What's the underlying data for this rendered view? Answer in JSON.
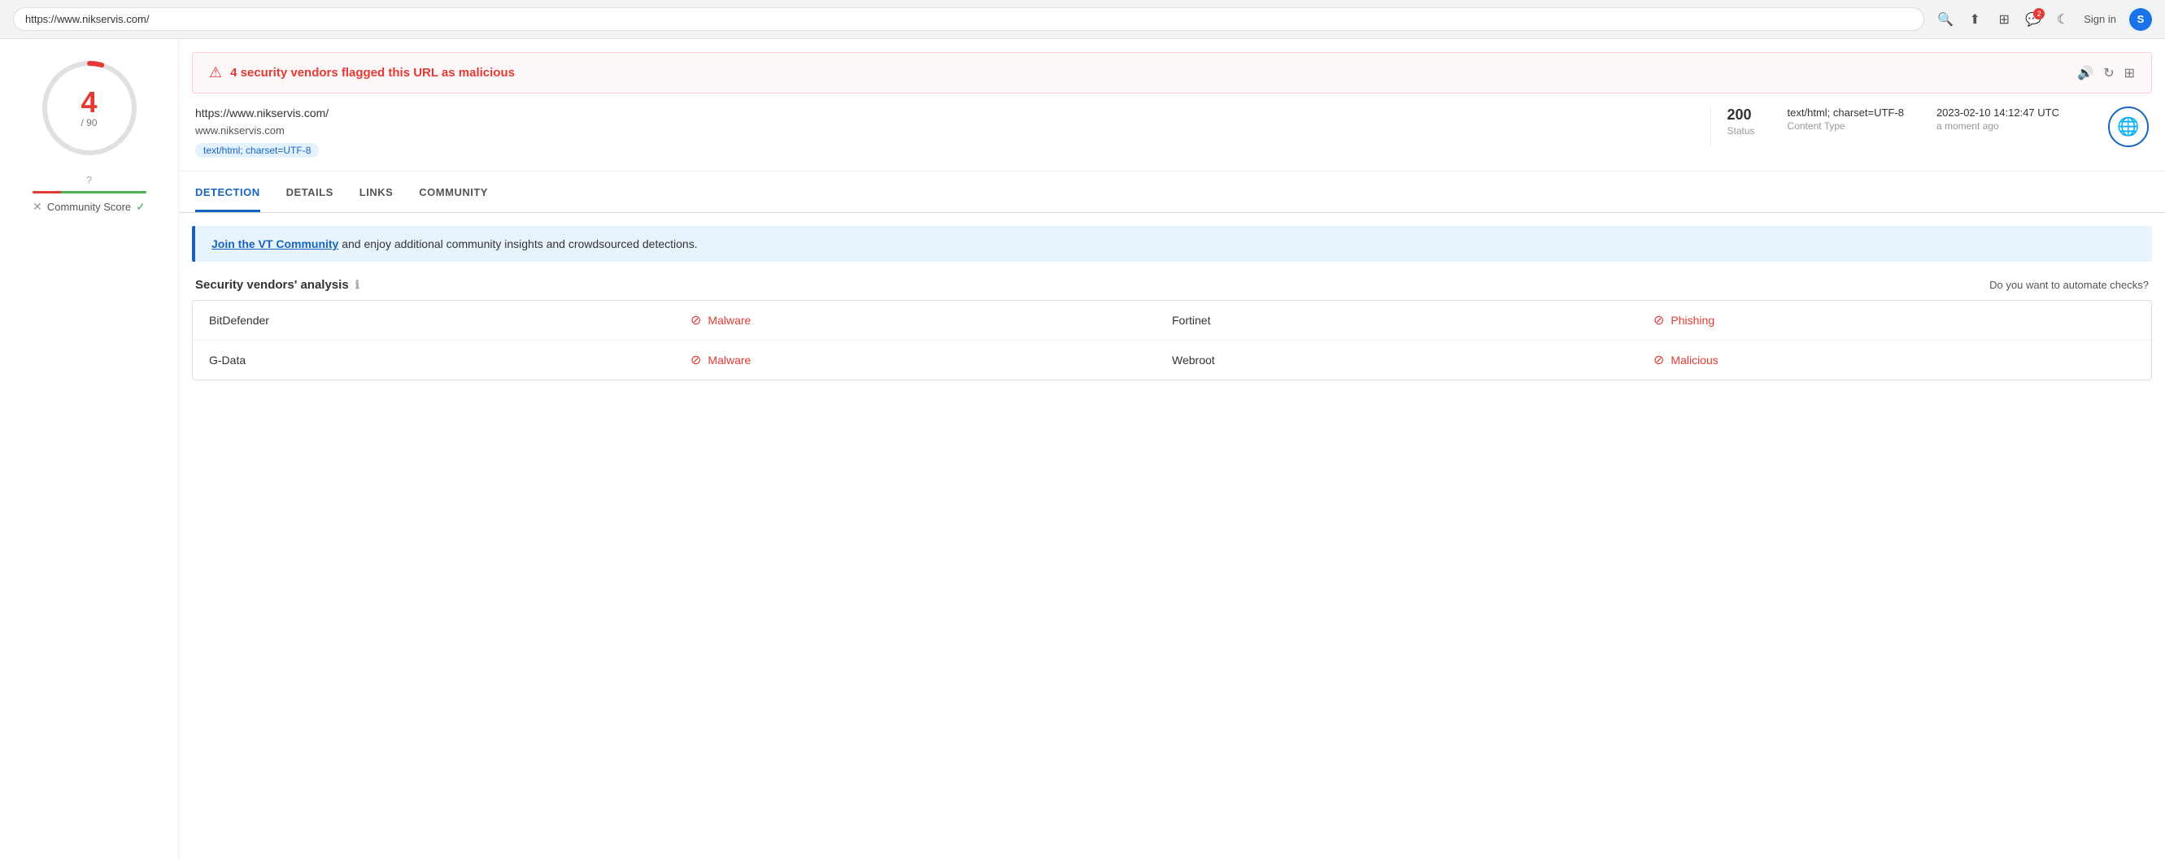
{
  "browser": {
    "url": "https://www.nikservis.com/",
    "sign_in": "S",
    "notification_count": "2"
  },
  "alert": {
    "icon": "⚠",
    "text": "4 security vendors flagged this URL as malicious"
  },
  "url_info": {
    "url": "https://www.nikservis.com/",
    "domain": "www.nikservis.com",
    "content_type_badge": "text/html; charset=UTF-8",
    "status_code": "200",
    "status_label": "Status",
    "content_type": "text/html; charset=UTF-8",
    "content_type_label": "Content Type",
    "timestamp": "2023-02-10 14:12:47 UTC",
    "timestamp_relative": "a moment ago"
  },
  "score": {
    "value": "4",
    "total": "/ 90",
    "gauge_red_pct": 4,
    "gauge_total": 90
  },
  "community_score": {
    "label": "Community Score"
  },
  "tabs": [
    {
      "label": "DETECTION",
      "active": true
    },
    {
      "label": "DETAILS",
      "active": false
    },
    {
      "label": "LINKS",
      "active": false
    },
    {
      "label": "COMMUNITY",
      "active": false
    }
  ],
  "join_bar": {
    "link_text": "Join the VT Community",
    "rest_text": " and enjoy additional community insights and crowdsourced detections."
  },
  "section": {
    "title": "Security vendors' analysis",
    "automate": "Do you want to automate checks?"
  },
  "vendors": [
    {
      "name": "BitDefender",
      "result": "Malware",
      "partner_name": "Fortinet",
      "partner_result": "Phishing"
    },
    {
      "name": "G-Data",
      "result": "Malware",
      "partner_name": "Webroot",
      "partner_result": "Malicious"
    }
  ]
}
